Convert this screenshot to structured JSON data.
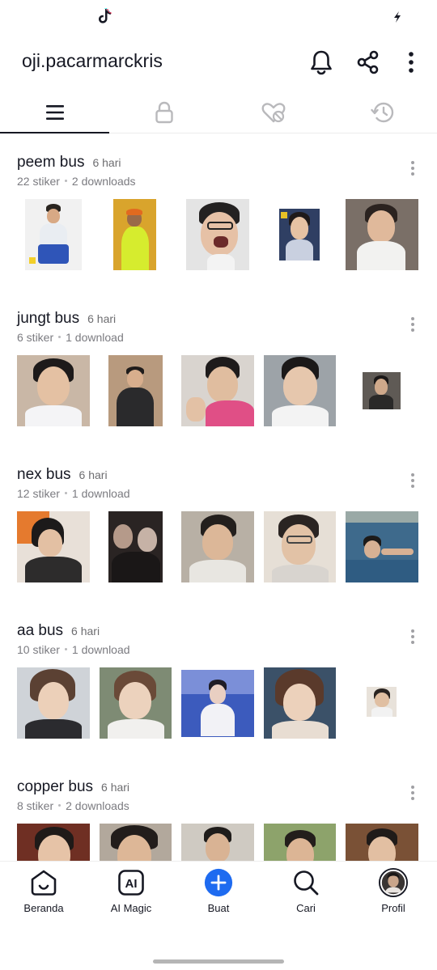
{
  "status_bar": {
    "app_icon": "tiktok-icon",
    "right_icon": "charging-icon"
  },
  "header": {
    "username": "oji.pacarmarckris",
    "icons": [
      "bell-icon",
      "share-icon",
      "more-vert-icon"
    ]
  },
  "tabs": [
    {
      "icon": "list-icon",
      "active": true
    },
    {
      "icon": "lock-icon",
      "active": false
    },
    {
      "icon": "heart-off-icon",
      "active": false
    },
    {
      "icon": "history-icon",
      "active": false
    }
  ],
  "packs": [
    {
      "title": "peem bus",
      "age": "6 hari",
      "count": "22 stiker",
      "downloads": "2 downloads"
    },
    {
      "title": "jungt bus",
      "age": "6 hari",
      "count": "6 stiker",
      "downloads": "1 download"
    },
    {
      "title": "nex bus",
      "age": "6 hari",
      "count": "12 stiker",
      "downloads": "1 download"
    },
    {
      "title": "aa bus",
      "age": "6 hari",
      "count": "10 stiker",
      "downloads": "1 download"
    },
    {
      "title": "copper bus",
      "age": "6 hari",
      "count": "8 stiker",
      "downloads": "2 downloads"
    }
  ],
  "bottom_nav": [
    {
      "label": "Beranda",
      "icon": "home-icon"
    },
    {
      "label": "AI Magic",
      "icon": "ai-icon"
    },
    {
      "label": "Buat",
      "icon": "plus-circle-icon"
    },
    {
      "label": "Cari",
      "icon": "search-icon"
    },
    {
      "label": "Profil",
      "icon": "avatar-icon"
    }
  ],
  "colors": {
    "accent": "#1e6bf0",
    "text": "#161823",
    "muted": "#7b7b80"
  }
}
